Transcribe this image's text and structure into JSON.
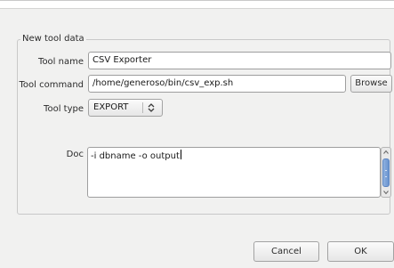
{
  "group": {
    "title": "New tool data"
  },
  "form": {
    "tool_name_label": "Tool name",
    "tool_name_value": "CSV Exporter",
    "tool_command_label": "Tool command",
    "tool_command_value": "/home/generoso/bin/csv_exp.sh",
    "browse_label": "Browse",
    "tool_type_label": "Tool type",
    "tool_type_value": "EXPORT",
    "doc_label": "Doc",
    "doc_value": "-i dbname -o output"
  },
  "buttons": {
    "cancel_label": "Cancel",
    "ok_label": "OK"
  },
  "icons": {
    "select_arrow": "updown-chevron-icon",
    "scroll_up": "scroll-up-arrow-icon",
    "scroll_down": "scroll-down-arrow-icon"
  },
  "colors": {
    "scroll_thumb": "#6a93cf",
    "dialog_bg": "#f1f1f0"
  }
}
